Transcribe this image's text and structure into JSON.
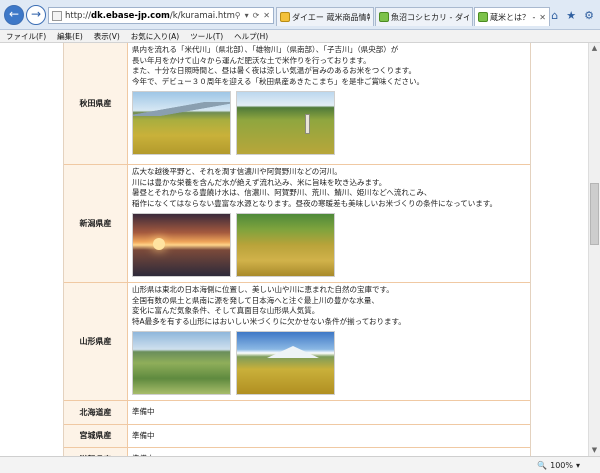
{
  "browser": {
    "url_prefix": "http://",
    "url_domain": "dk.ebase-jp.com",
    "url_path": "/k/kuramai.html",
    "address_tools": [
      "⚲",
      "▾",
      "⟳",
      "✕"
    ],
    "tabs": [
      {
        "label": "ダイエー 蔵米商品情報...",
        "active": false
      },
      {
        "label": "魚沼コシヒカリ - ダイエー...",
        "active": false
      },
      {
        "label": "蔵米とは？ - ダイエ...",
        "active": true
      }
    ],
    "tab_close": "✕",
    "icons": {
      "home": "⌂",
      "favorites": "★",
      "settings": "⚙"
    },
    "menu": [
      "ファイル(F)",
      "編集(E)",
      "表示(V)",
      "お気に入り(A)",
      "ツール(T)",
      "ヘルプ(H)"
    ],
    "zoom": "100%",
    "zoom_icon": "🔍",
    "zoom_arrow": "▾"
  },
  "rows": [
    {
      "prefecture": "秋田県産",
      "lines": [
        "県内を流れる「米代川」（県北部）、「雄物川」（県南部）、「子吉川」（県央部）が",
        "長い年月をかけて山々から運んだ肥沃な土で米作りを行っております。",
        "また、十分な日照時間と、昼は暑く夜は涼しい気温が旨みのあるお米をつくります。",
        "今年で、デビュー３０周年を迎える「秋田県産あきたこまち」を是非ご賞味ください。"
      ]
    },
    {
      "prefecture": "新潟県産",
      "lines": [
        "広大な越後平野と、それを潤す信濃川や阿賀野川などの河川。",
        "川には豊かな栄養を含んだ水が絶えず流れ込み、米に旨味を吹き込みます。",
        "暑昼とそれからなる豊饒け水は、信濃川、阿賀野川、荒川、鯖川、姫川などへ流れこみ、",
        "稲作になくてはならない豊富な水源となります。昼夜の寒暖差も美味しいお米づくりの条件になっています。"
      ]
    },
    {
      "prefecture": "山形県産",
      "lines": [
        "山形県は東北の日本海側に位置し、美しい山や川に恵まれた自然の宝庫です。",
        "全国有数の県土と県南に源を発して日本海へと注ぐ最上川の豊かな水量、",
        "変化に富んだ気象条件、そして真面目な山形県人気質。",
        "特A最多を有する山形にはおいしい米づくりに欠かせない条件が揃っております。"
      ]
    },
    {
      "prefecture": "北海道産",
      "status": "準備中"
    },
    {
      "prefecture": "宮城県産",
      "status": "準備中"
    },
    {
      "prefecture": "滋賀県産",
      "status": "準備中"
    }
  ],
  "scroll": {
    "up": "▲",
    "down": "▼"
  }
}
